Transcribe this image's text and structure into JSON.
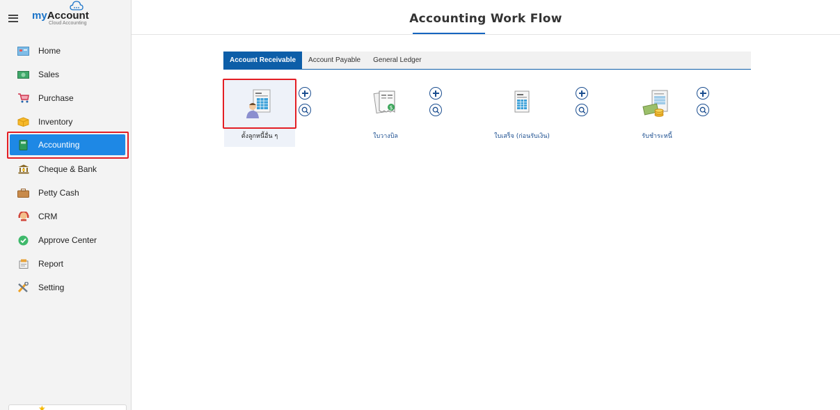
{
  "brand": {
    "name_prefix": "my",
    "name_main": "Account",
    "subtitle": "Cloud Accounting"
  },
  "sidebar": {
    "items": [
      {
        "label": "Home",
        "icon": "home-icon"
      },
      {
        "label": "Sales",
        "icon": "money-icon"
      },
      {
        "label": "Purchase",
        "icon": "cart-icon"
      },
      {
        "label": "Inventory",
        "icon": "box-icon"
      },
      {
        "label": "Accounting",
        "icon": "book-icon",
        "active": true
      },
      {
        "label": "Cheque & Bank",
        "icon": "bank-icon"
      },
      {
        "label": "Petty Cash",
        "icon": "briefcase-icon"
      },
      {
        "label": "CRM",
        "icon": "crm-icon"
      },
      {
        "label": "Approve Center",
        "icon": "check-circle-icon"
      },
      {
        "label": "Report",
        "icon": "report-icon"
      },
      {
        "label": "Setting",
        "icon": "tools-icon"
      }
    ]
  },
  "header": {
    "title": "Accounting Work Flow"
  },
  "tabs": [
    {
      "label": "Account Receivable",
      "active": true
    },
    {
      "label": "Account Payable"
    },
    {
      "label": "General Ledger"
    }
  ],
  "workflow": [
    {
      "label": "ตั้งลูกหนี้อื่น ๆ",
      "icon": "customer-document-icon",
      "selected": true
    },
    {
      "label": "ใบวางบิล",
      "icon": "billing-note-icon"
    },
    {
      "label": "ใบเสร็จ (ก่อนรับเงิน)",
      "icon": "receipt-icon"
    },
    {
      "label": "รับชำระหนี้",
      "icon": "payment-receive-icon"
    }
  ],
  "colors": {
    "accent": "#1e88e5",
    "tab_active": "#0d5ea8",
    "highlight": "#e31e24",
    "link": "#1a4d8f"
  }
}
